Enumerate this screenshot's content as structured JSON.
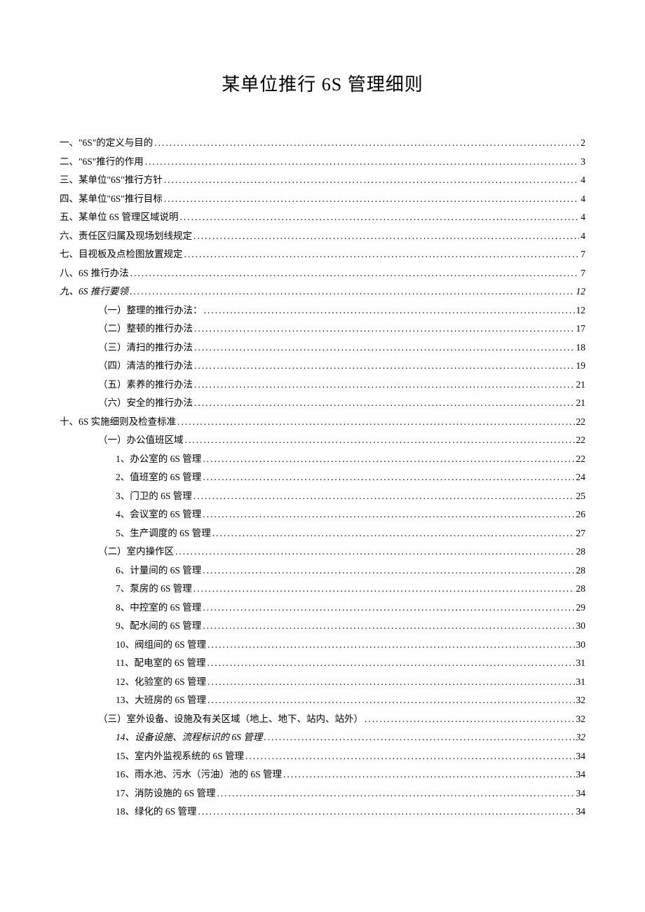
{
  "title": "某单位推行 6S 管理细则",
  "toc": [
    {
      "level": 1,
      "label": "一、\"6S\"的定义与目的",
      "page": "2",
      "italic": false
    },
    {
      "level": 1,
      "label": "二、\"6S\"推行的作用",
      "page": "3",
      "italic": false
    },
    {
      "level": 1,
      "label": "三、某单位\"6S\"推行方针",
      "page": "4",
      "italic": false
    },
    {
      "level": 1,
      "label": "四、某单位\"6S\"推行目标",
      "page": "4",
      "italic": false
    },
    {
      "level": 1,
      "label": "五、某单位 6S 管理区域说明",
      "page": "4",
      "italic": false
    },
    {
      "level": 1,
      "label": "六、责任区归属及现场划线规定",
      "page": "4",
      "italic": false
    },
    {
      "level": 1,
      "label": "七、目视板及点检图放置规定",
      "page": "7",
      "italic": false
    },
    {
      "level": 1,
      "label": "八、6S 推行办法",
      "page": "7",
      "italic": false
    },
    {
      "level": 1,
      "label": "九、6S 推行要领",
      "page": "12",
      "italic": true
    },
    {
      "level": 2,
      "label": "（一）整理的推行办法：",
      "page": "12",
      "italic": false
    },
    {
      "level": 2,
      "label": "（二）整顿的推行办法",
      "page": "17",
      "italic": false
    },
    {
      "level": 2,
      "label": "（三）清扫的推行办法",
      "page": "18",
      "italic": false
    },
    {
      "level": 2,
      "label": "（四）清洁的推行办法",
      "page": "19",
      "italic": false
    },
    {
      "level": 2,
      "label": "（五）素养的推行办法",
      "page": "21",
      "italic": false
    },
    {
      "level": 2,
      "label": "（六）安全的推行办法",
      "page": "21",
      "italic": false
    },
    {
      "level": 1,
      "label": "十、6S 实施细则及检查标准",
      "page": "22",
      "italic": false
    },
    {
      "level": 2,
      "label": "（一）办公值班区域",
      "page": "22",
      "italic": false
    },
    {
      "level": 3,
      "label": "1、办公室的 6S 管理",
      "page": "22",
      "italic": false
    },
    {
      "level": 3,
      "label": "2、值班室的 6S 管理",
      "page": "24",
      "italic": false
    },
    {
      "level": 3,
      "label": "3、门卫的 6S 管理",
      "page": "25",
      "italic": false
    },
    {
      "level": 3,
      "label": "4、会议室的 6S 管理",
      "page": "26",
      "italic": false
    },
    {
      "level": 3,
      "label": "5、生产调度的 6S 管理",
      "page": "27",
      "italic": false
    },
    {
      "level": 2,
      "label": "（二）室内操作区",
      "page": "28",
      "italic": false
    },
    {
      "level": 3,
      "label": "6、计量间的 6S 管理",
      "page": "28",
      "italic": false
    },
    {
      "level": 3,
      "label": "7、泵房的 6S 管理",
      "page": "28",
      "italic": false
    },
    {
      "level": 3,
      "label": "8、中控室的 6S 管理",
      "page": "29",
      "italic": false
    },
    {
      "level": 3,
      "label": "9、配水间的 6S 管理",
      "page": "30",
      "italic": false
    },
    {
      "level": 3,
      "label": "10、阀组间的 6S 管理",
      "page": "30",
      "italic": false
    },
    {
      "level": 3,
      "label": "11、配电室的 6S 管理",
      "page": "31",
      "italic": false
    },
    {
      "level": 3,
      "label": "12、化验室的 6S 管理",
      "page": "31",
      "italic": false
    },
    {
      "level": 3,
      "label": "13、大班房的 6S 管理",
      "page": "32",
      "italic": false
    },
    {
      "level": 2,
      "label": "（三）室外设备、设施及有关区域（地上、地下、站内、站外）",
      "page": "32",
      "italic": false
    },
    {
      "level": 3,
      "label": "14、设备设施、流程标识的 6S 管理",
      "page": "32",
      "italic": true
    },
    {
      "level": 3,
      "label": "15、室内外监视系统的 6S 管理",
      "page": "34",
      "italic": false
    },
    {
      "level": 3,
      "label": "16、雨水池、污水（污油）池的 6S 管理",
      "page": "34",
      "italic": false
    },
    {
      "level": 3,
      "label": "17、消防设施的 6S 管理",
      "page": "34",
      "italic": false
    },
    {
      "level": 3,
      "label": "18、绿化的 6S 管理",
      "page": "34",
      "italic": false
    }
  ]
}
